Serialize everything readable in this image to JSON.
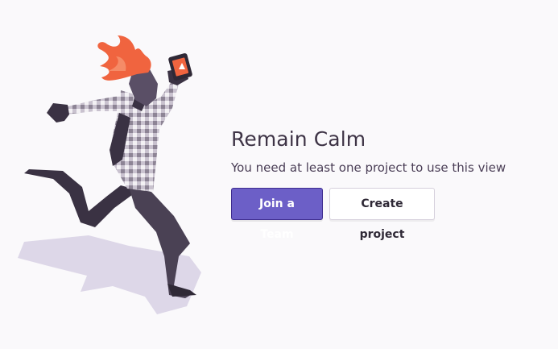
{
  "empty_state": {
    "title": "Remain Calm",
    "message": "You need at least one project to use this view"
  },
  "actions": {
    "join_team_label": "Join a Team",
    "create_project_label": "Create project"
  },
  "colors": {
    "primary": "#6c5fc7",
    "hair": "#f0643f",
    "shadow": "#d9d3e6"
  },
  "illustration": {
    "icon": "running-person-with-phone-illustration"
  }
}
